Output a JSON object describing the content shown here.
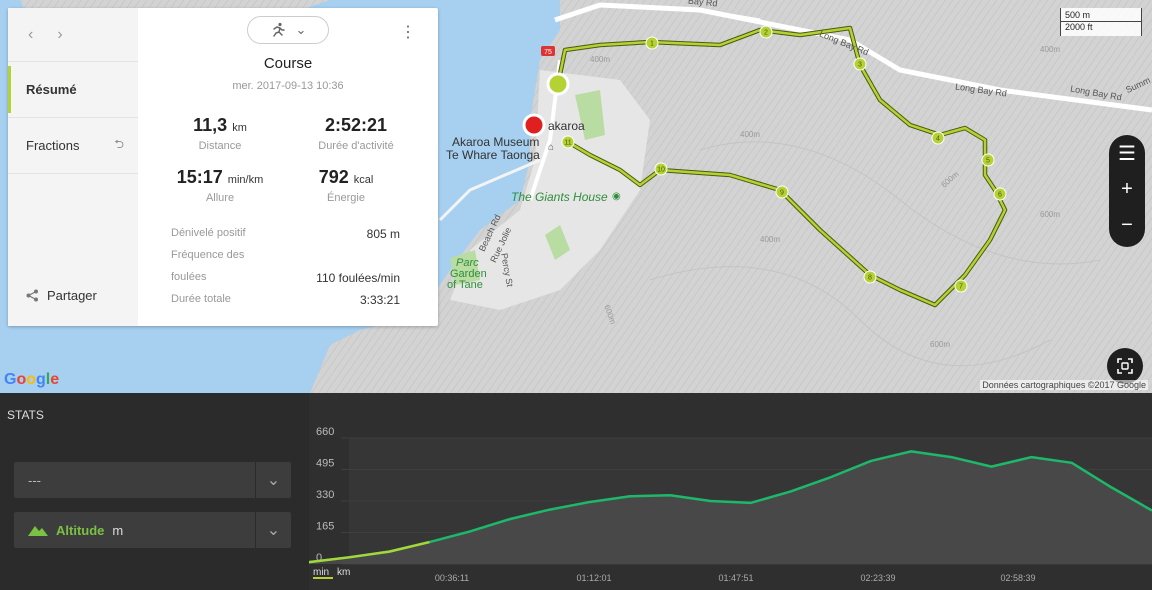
{
  "map": {
    "scale": {
      "metric": "500 m",
      "imperial": "2000 ft"
    },
    "roads": [
      "Bay Rd",
      "Long Bay Rd",
      "Long Bay Rd",
      "Long Bay Rd",
      "Summ",
      "Beach Rd",
      "Rue Jolie",
      "Percy St"
    ],
    "badge_75": "75",
    "places": {
      "akaroa": "akaroa",
      "museum_line1": "Akaroa Museum",
      "museum_line2": "Te Whare Taonga",
      "giants_house": "The Giants House",
      "parc_line1": "Parc",
      "parc_line2": "Garden",
      "parc_line3": "of Tane"
    },
    "contours": [
      "400m",
      "400m",
      "600m",
      "400m",
      "600m",
      "600m",
      "600m",
      "400m"
    ],
    "km_markers": [
      "1",
      "2",
      "3",
      "4",
      "5",
      "6",
      "7",
      "8",
      "9",
      "10",
      "11"
    ],
    "google": "Google",
    "attribution": "Données cartographiques ©2017 Google",
    "colors": {
      "route": "#b4d233",
      "start": "#b4d233",
      "end": "#e02020"
    }
  },
  "card": {
    "nav_prev": "‹",
    "nav_next": "›",
    "sidebar": {
      "summary": "Résumé",
      "laps": "Fractions",
      "share": "Partager"
    },
    "sport_icon": "running-icon",
    "title": "Course",
    "date": "mer. 2017-09-13 10:36",
    "stats": {
      "distance": {
        "value": "11,3",
        "unit": "km",
        "label": "Distance"
      },
      "duration": {
        "value": "2:52:21",
        "unit": "",
        "label": "Durée d'activité"
      },
      "pace": {
        "value": "15:17",
        "unit": "min/km",
        "label": "Allure"
      },
      "energy": {
        "value": "792",
        "unit": "kcal",
        "label": "Énergie"
      }
    },
    "details": {
      "ascent_label": "Dénivelé positif",
      "ascent_value": "805 m",
      "cadence_label_1": "Fréquence des",
      "cadence_label_2": "foulées",
      "cadence_value": "110 foulées/min",
      "total_label": "Durée totale",
      "total_value": "3:33:21"
    }
  },
  "stats_panel": {
    "title": "STATS",
    "select1": "---",
    "select2_label": "Altitude",
    "select2_unit": "m"
  },
  "chart_data": {
    "type": "area",
    "ylabel": "",
    "yticks": [
      0,
      165,
      330,
      495,
      660
    ],
    "ylim": [
      0,
      660
    ],
    "x_unit_options": [
      "min",
      "km"
    ],
    "x_unit_selected": "min",
    "xticks": [
      "00:36:11",
      "01:12:01",
      "01:47:51",
      "02:23:39",
      "02:58:39"
    ],
    "x_minutes": [
      0,
      10,
      20,
      30,
      40,
      50,
      60,
      70,
      80,
      90,
      100,
      110,
      120,
      130,
      140,
      150,
      160,
      170,
      180,
      190,
      200,
      210
    ],
    "altitude": [
      10,
      35,
      65,
      115,
      170,
      235,
      285,
      325,
      355,
      360,
      330,
      320,
      380,
      455,
      540,
      590,
      560,
      510,
      560,
      530,
      400,
      280
    ],
    "series_color": "#1db86a"
  }
}
